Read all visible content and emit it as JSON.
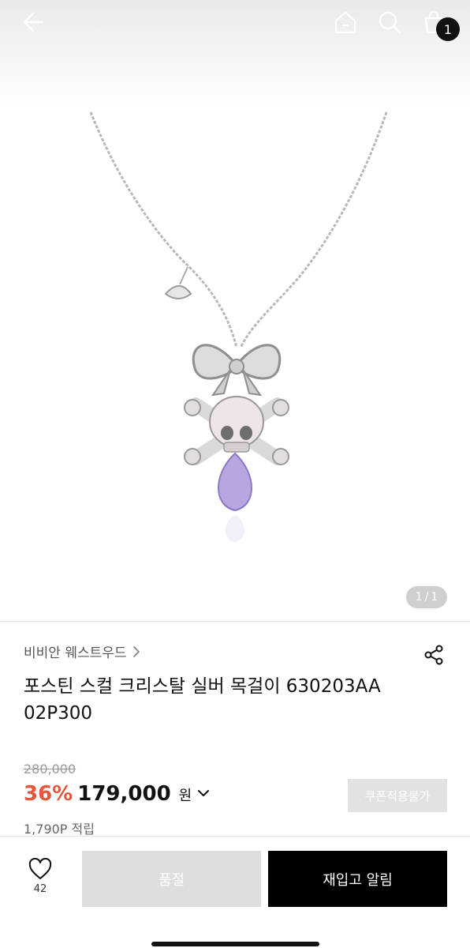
{
  "header": {
    "cart_count": "1"
  },
  "gallery": {
    "pager_current": "1",
    "pager_separator": "/",
    "pager_total": "1"
  },
  "product": {
    "brand": "비비안 웨스트우드",
    "title": "포스틴 스컬 크리스탈 실버 목걸이 630203AA 02P300",
    "original_price": "280,000",
    "discount_rate": "36%",
    "price": "179,000",
    "currency": "원",
    "points": "1,790P 적립",
    "coupon_label": "쿠폰적용불가"
  },
  "actions": {
    "like_count": "42",
    "soldout_label": "품절",
    "restock_label": "재입고 알림"
  },
  "colors": {
    "discount": "#e4573b",
    "primary_button": "#000000",
    "disabled_button": "#dedede"
  }
}
